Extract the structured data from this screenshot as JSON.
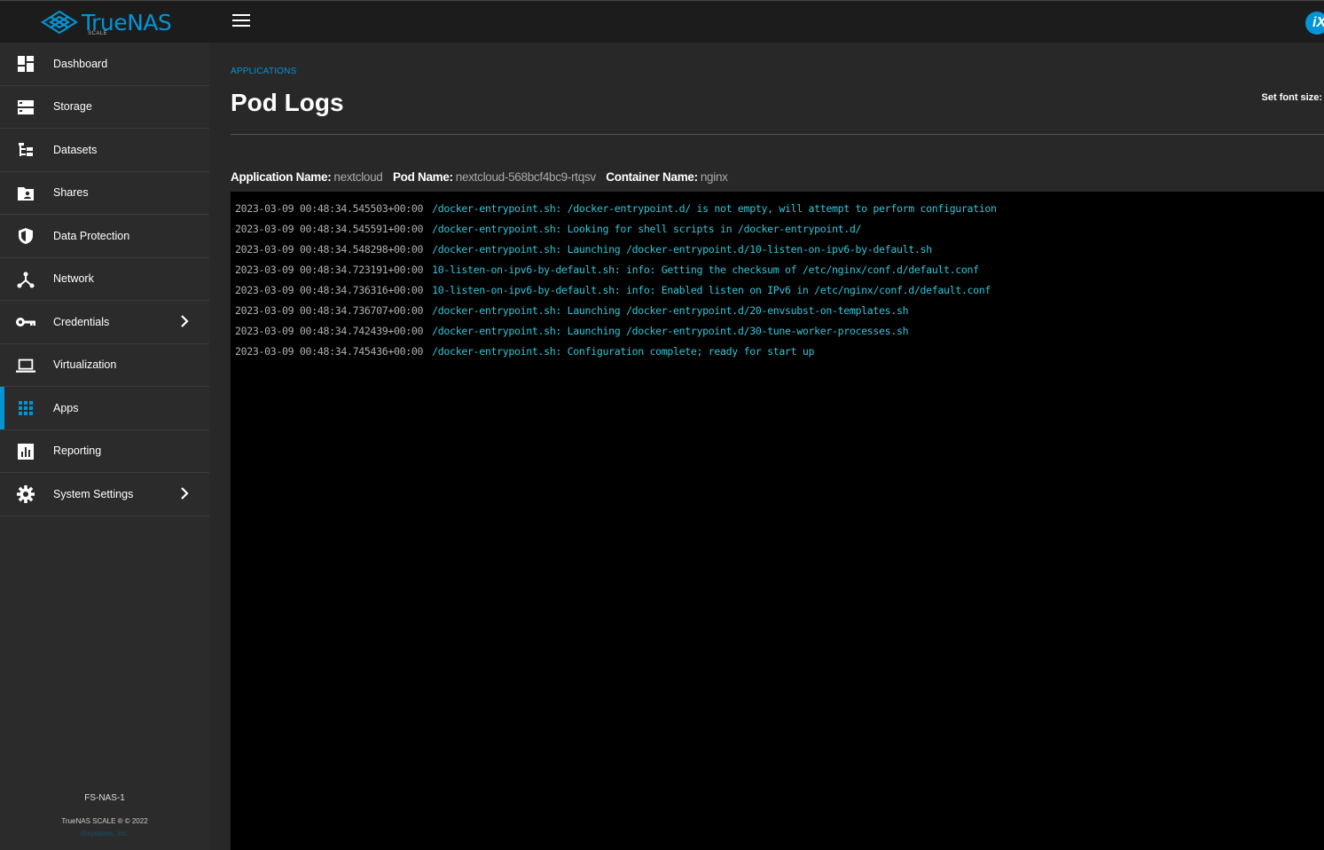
{
  "brand": {
    "name": "TrueNAS",
    "edition": "SCALE",
    "colors": {
      "accent": "#0095d5",
      "topbar": "#1c1c1c",
      "sidebar": "#2b2b2b",
      "log_text": "#2ec4d6"
    }
  },
  "topbar": {
    "menu_icon": "hamburger-icon",
    "vendor_logo_icon": "ixsystems-logo-icon",
    "vendor_logo_text": "iX"
  },
  "sidebar": {
    "items": [
      {
        "label": "Dashboard",
        "icon": "dashboard-icon"
      },
      {
        "label": "Storage",
        "icon": "storage-icon"
      },
      {
        "label": "Datasets",
        "icon": "datasets-icon"
      },
      {
        "label": "Shares",
        "icon": "shares-icon"
      },
      {
        "label": "Data Protection",
        "icon": "shield-icon"
      },
      {
        "label": "Network",
        "icon": "network-icon"
      },
      {
        "label": "Credentials",
        "icon": "key-icon",
        "has_submenu": true
      },
      {
        "label": "Virtualization",
        "icon": "laptop-icon"
      },
      {
        "label": "Apps",
        "icon": "apps-grid-icon",
        "active": true
      },
      {
        "label": "Reporting",
        "icon": "reporting-icon"
      },
      {
        "label": "System Settings",
        "icon": "gear-icon",
        "has_submenu": true
      }
    ],
    "footer": {
      "hostname": "FS-NAS-1",
      "copyright": "TrueNAS SCALE ® © 2022",
      "company": "iXsystems, Inc."
    }
  },
  "main": {
    "breadcrumb": "APPLICATIONS",
    "title": "Pod Logs",
    "font_size_label": "Set font size:",
    "meta": {
      "app_key": "Application Name:",
      "app_value": "nextcloud",
      "pod_key": "Pod Name:",
      "pod_value": "nextcloud-568bcf4bc9-rtqsv",
      "container_key": "Container Name:",
      "container_value": "nginx"
    },
    "logs": [
      {
        "ts": "2023-03-09 00:48:34.545503+00:00",
        "msg": "/docker-entrypoint.sh: /docker-entrypoint.d/ is not empty, will attempt to perform configuration"
      },
      {
        "ts": "2023-03-09 00:48:34.545591+00:00",
        "msg": "/docker-entrypoint.sh: Looking for shell scripts in /docker-entrypoint.d/"
      },
      {
        "ts": "2023-03-09 00:48:34.548298+00:00",
        "msg": "/docker-entrypoint.sh: Launching /docker-entrypoint.d/10-listen-on-ipv6-by-default.sh"
      },
      {
        "ts": "2023-03-09 00:48:34.723191+00:00",
        "msg": "10-listen-on-ipv6-by-default.sh: info: Getting the checksum of /etc/nginx/conf.d/default.conf"
      },
      {
        "ts": "2023-03-09 00:48:34.736316+00:00",
        "msg": "10-listen-on-ipv6-by-default.sh: info: Enabled listen on IPv6 in /etc/nginx/conf.d/default.conf"
      },
      {
        "ts": "2023-03-09 00:48:34.736707+00:00",
        "msg": "/docker-entrypoint.sh: Launching /docker-entrypoint.d/20-envsubst-on-templates.sh"
      },
      {
        "ts": "2023-03-09 00:48:34.742439+00:00",
        "msg": "/docker-entrypoint.sh: Launching /docker-entrypoint.d/30-tune-worker-processes.sh"
      },
      {
        "ts": "2023-03-09 00:48:34.745436+00:00",
        "msg": "/docker-entrypoint.sh: Configuration complete; ready for start up"
      }
    ]
  }
}
